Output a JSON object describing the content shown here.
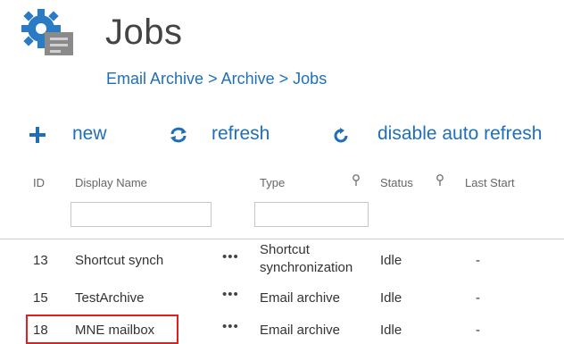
{
  "page": {
    "title": "Jobs",
    "breadcrumb": [
      "Email Archive",
      "Archive",
      "Jobs"
    ],
    "breadcrumb_sep": ">"
  },
  "toolbar": {
    "new_label": "new",
    "new_icon": "plus-icon",
    "refresh_label": "refresh",
    "refresh_icon": "refresh-icon",
    "disable_label": "disable auto refresh",
    "disable_icon": "auto-refresh-icon",
    "accent": "#1f6fb8"
  },
  "table": {
    "columns": [
      "ID",
      "Display Name",
      "Type",
      "Status",
      "Last Start"
    ],
    "filter_values": {
      "display_name": "",
      "type": ""
    },
    "rows": [
      {
        "id": "13",
        "name": "Shortcut synch",
        "menu": "•••",
        "type": "Shortcut synchronization",
        "type_lines": [
          "Shortcut",
          "synchronization"
        ],
        "status": "Idle",
        "last_start": "-"
      },
      {
        "id": "15",
        "name": "TestArchive",
        "menu": "•••",
        "type": "Email archive",
        "status": "Idle",
        "last_start": "-"
      },
      {
        "id": "18",
        "name": "MNE mailbox",
        "menu": "•••",
        "type": "Email archive",
        "status": "Idle",
        "last_start": "-"
      }
    ],
    "highlight_color": "#e02020"
  }
}
